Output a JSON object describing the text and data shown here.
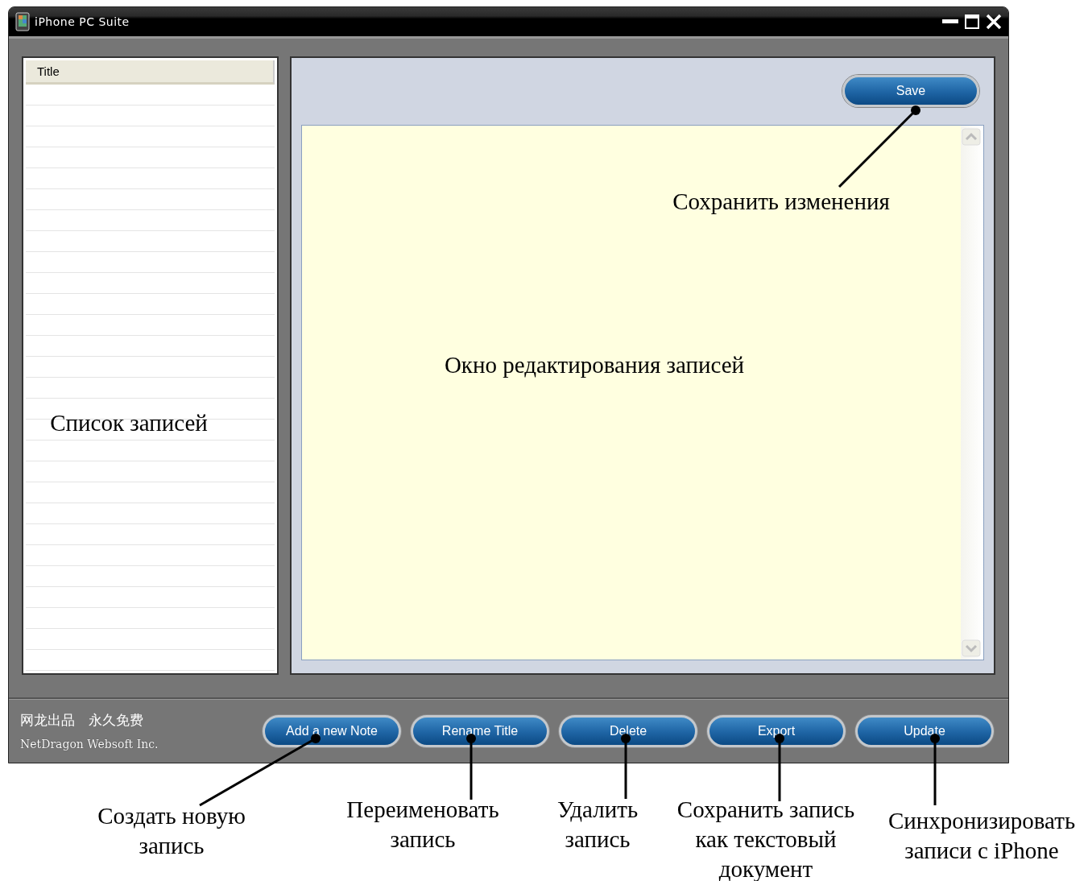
{
  "window": {
    "title": "iPhone PC Suite"
  },
  "notes_list": {
    "columns": [
      "Title"
    ]
  },
  "editor": {
    "save_button": "Save"
  },
  "footer": {
    "brand": "网龙出品　永久免费",
    "company": "NetDragon Websoft Inc."
  },
  "buttons": [
    "Add a new Note",
    "Rename Title",
    "Delete",
    "Export",
    "Update"
  ],
  "annotations": [
    {
      "text": "Сохранить изменения"
    },
    {
      "text": "Окно редактирования записей"
    },
    {
      "text": "Список записей"
    },
    {
      "text": "Создать новую\nзапись"
    },
    {
      "text": "Переименовать\nзапись"
    },
    {
      "text": "Удалить\nзапись"
    },
    {
      "text": "Сохранить запись\nкак текстовый\nдокумент"
    },
    {
      "text": "Синхронизировать\nзаписи с iPhone"
    }
  ]
}
